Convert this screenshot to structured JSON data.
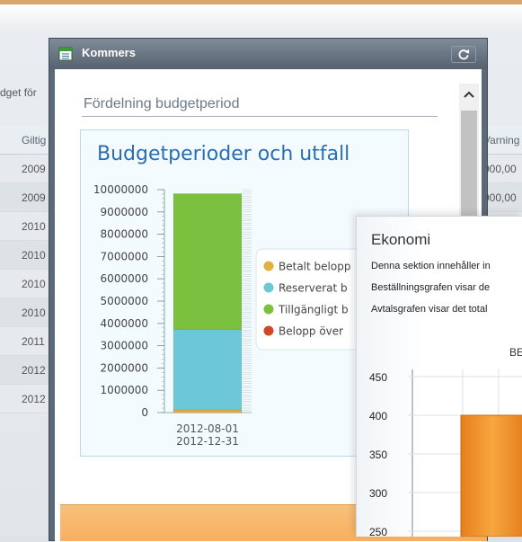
{
  "background": {
    "label_partial": "dget för",
    "table": {
      "left_header": "Giltig",
      "right_header": "Varning",
      "left_rows": [
        "2009",
        "2009",
        "2010",
        "2010",
        "2010",
        "2010",
        "2011",
        "2012",
        "2012"
      ],
      "right_rows": [
        "000,00",
        "000,00"
      ]
    }
  },
  "window": {
    "title": "Kommers",
    "icon": "document-list-icon",
    "refresh_icon": "refresh-icon"
  },
  "section": {
    "title": "Fördelning budgetperiod"
  },
  "chart_data": {
    "type": "bar",
    "title": "Budgetperioder och utfall",
    "categories": [
      "2012-08-01\n2012-12-31"
    ],
    "category_lines": [
      "2012-08-01",
      "2012-12-31"
    ],
    "series": [
      {
        "name": "Betalt belopp",
        "values": [
          120000
        ],
        "color": "#e0b040"
      },
      {
        "name": "Reserverat b",
        "values": [
          3600000
        ],
        "color": "#6cc8d8"
      },
      {
        "name": "Tillgängligt b",
        "values": [
          6100000
        ],
        "color": "#7cc040"
      },
      {
        "name": "Belopp över",
        "values": [
          0
        ],
        "color": "#d04828"
      }
    ],
    "stacked": true,
    "ylim": [
      0,
      10000000
    ],
    "yticks": [
      "10000000",
      "9000000",
      "8000000",
      "7000000",
      "6000000",
      "5000000",
      "4000000",
      "3000000",
      "2000000",
      "1000000",
      "0"
    ],
    "legend": "right"
  },
  "popup": {
    "title": "Ekonomi",
    "lines": [
      "Denna sektion innehåller in",
      "Beställningsgrafen visar de",
      "Avtalsgrafen visar det total"
    ],
    "chart_title_partial": "BE",
    "chart_data": {
      "type": "bar",
      "yticks": [
        "450",
        "400",
        "350",
        "300",
        "250"
      ],
      "values": [
        400
      ],
      "color": "#f39a30"
    }
  }
}
